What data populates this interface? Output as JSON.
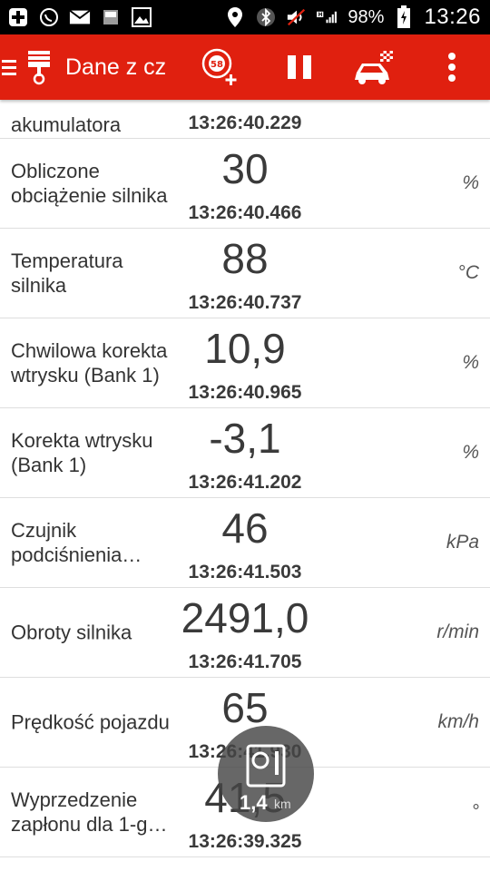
{
  "status_bar": {
    "icons": [
      "add-icon",
      "whatsapp-icon",
      "mail-icon",
      "sim-3g-icon",
      "image-icon",
      "location-icon",
      "bluetooth-icon",
      "mute-icon",
      "signal-h-icon",
      "battery-icon"
    ],
    "battery": "98%",
    "time": "13:26"
  },
  "toolbar": {
    "title": "Dane z cz",
    "speed_badge": "58"
  },
  "rows": [
    {
      "label": "akumulatora",
      "value": "",
      "time": "13:26:40.229",
      "unit": ""
    },
    {
      "label": "Obliczone obciążenie silnika",
      "value": "30",
      "time": "13:26:40.466",
      "unit": "%"
    },
    {
      "label": "Temperatura silnika",
      "value": "88",
      "time": "13:26:40.737",
      "unit": "°C"
    },
    {
      "label": "Chwilowa korekta wtrysku (Bank 1)",
      "value": "10,9",
      "time": "13:26:40.965",
      "unit": "%"
    },
    {
      "label": "Korekta wtrysku (Bank 1)",
      "value": "-3,1",
      "time": "13:26:41.202",
      "unit": "%"
    },
    {
      "label": "Czujnik podciśnienia…",
      "value": "46",
      "time": "13:26:41.503",
      "unit": "kPa"
    },
    {
      "label": "Obroty silnika",
      "value": "2491,0",
      "time": "13:26:41.705",
      "unit": "r/min"
    },
    {
      "label": "Prędkość pojazdu",
      "value": "65",
      "time": "13:26:41.930",
      "unit": "km/h"
    },
    {
      "label": "Wyprzedzenie zapłonu dla 1-g…",
      "value": "41,5",
      "time": "13:26:39.325",
      "unit": "°"
    }
  ],
  "bubble": {
    "value": "1,4",
    "unit": "km"
  }
}
